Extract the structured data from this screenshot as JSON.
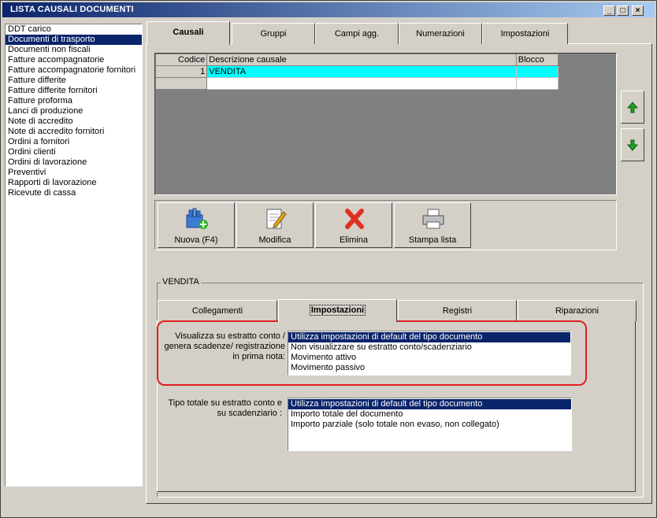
{
  "window": {
    "title": "LISTA CAUSALI DOCUMENTI"
  },
  "doc_types": [
    "DDT carico",
    "Documenti di trasporto",
    "Documenti non fiscali",
    "Fatture accompagnatorie",
    "Fatture accompagnatorie fornitori",
    "Fatture differite",
    "Fatture differite fornitori",
    "Fatture proforma",
    "Lanci di produzione",
    "Note di accredito",
    "Note di accredito fornitori",
    "Ordini a fornitori",
    "Ordini clienti",
    "Ordini di lavorazione",
    "Preventivi",
    "Rapporti di lavorazione",
    "Ricevute di cassa"
  ],
  "doc_types_selected_index": 1,
  "tabs": [
    "Causali",
    "Gruppi",
    "Campi agg.",
    "Numerazioni",
    "Impostazioni"
  ],
  "grid": {
    "headers": {
      "code": "Codice",
      "desc": "Descrizione causale",
      "block": "Blocco"
    },
    "rows": [
      {
        "code": "1",
        "desc": "VENDITA",
        "block": ""
      }
    ]
  },
  "actions": {
    "new": "Nuova (F4)",
    "edit": "Modifica",
    "delete": "Elimina",
    "print": "Stampa lista"
  },
  "detail": {
    "group_title": "VENDITA",
    "subtabs": [
      "Collegamenti",
      "Impostazioni",
      "Registri",
      "Riparazioni"
    ],
    "field1": {
      "label_lines": [
        "Visualizza su estratto conto /",
        "genera scadenze/ registrazione",
        "in prima nota:"
      ],
      "options": [
        "Utilizza impostazioni di default del tipo documento",
        "Non visualizzare su estratto conto/scadenziario",
        "Movimento attivo",
        "Movimento passivo"
      ]
    },
    "field2": {
      "label_lines": [
        "Tipo totale su estratto conto e",
        "su scadenziario :"
      ],
      "options": [
        "Utilizza impostazioni di default del tipo documento",
        "Importo totale del documento",
        "Importo parziale (solo totale non evaso, non collegato)"
      ]
    }
  },
  "colors": {
    "selection": "#0a246a",
    "current_row": "#00ffff",
    "highlight": "#e02020"
  }
}
